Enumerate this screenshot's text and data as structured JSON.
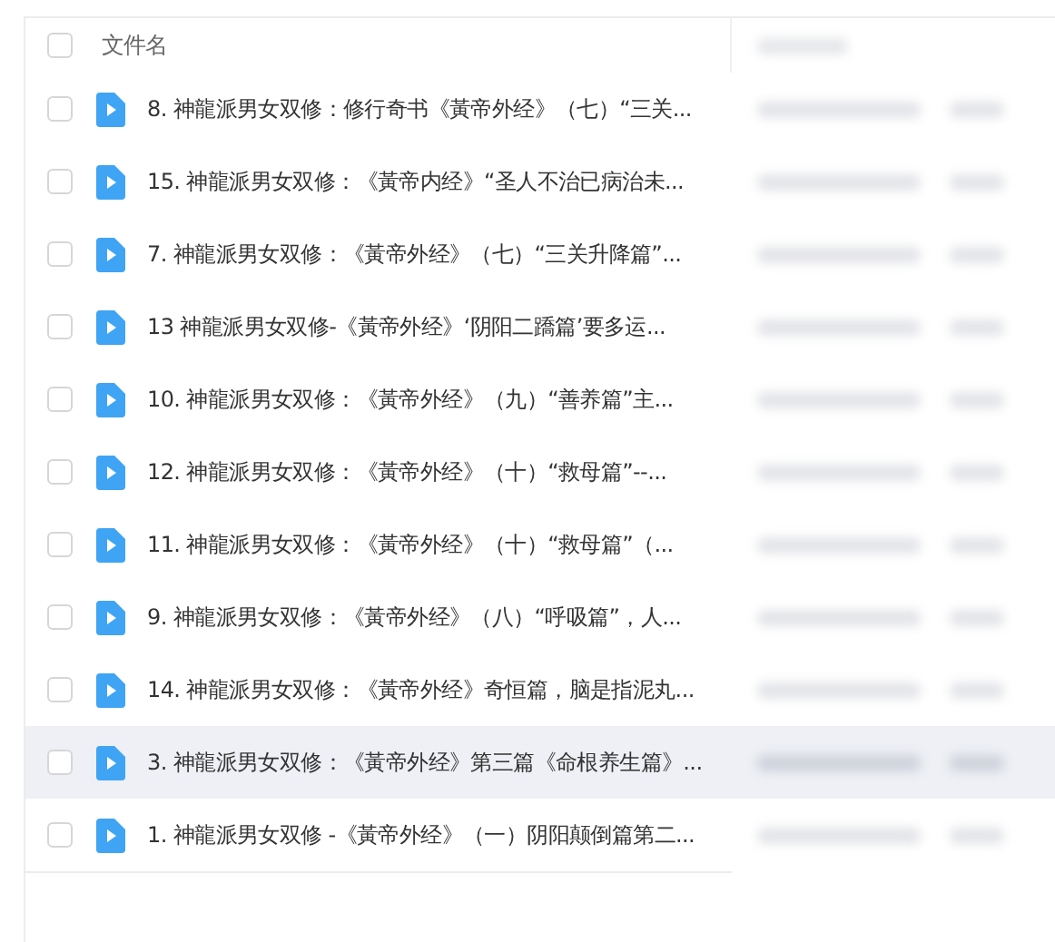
{
  "header": {
    "checked": false,
    "column_1": "文件名"
  },
  "rows": [
    {
      "name": "8. 神龍派男女双修：修行奇书《黃帝外经》（七）“三关...",
      "checked": false,
      "highlighted": false
    },
    {
      "name": "15. 神龍派男女双修：《黃帝内经》“圣人不治已病治未...",
      "checked": false,
      "highlighted": false
    },
    {
      "name": "7. 神龍派男女双修：《黃帝外经》（七）“三关升降篇”...",
      "checked": false,
      "highlighted": false
    },
    {
      "name": "13 神龍派男女双修-《黃帝外经》‘阴阳二蹻篇’要多运...",
      "checked": false,
      "highlighted": false
    },
    {
      "name": "10. 神龍派男女双修：《黃帝外经》（九）“善养篇”主...",
      "checked": false,
      "highlighted": false
    },
    {
      "name": "12. 神龍派男女双修：《黃帝外经》（十）“救母篇”--...",
      "checked": false,
      "highlighted": false
    },
    {
      "name": "11. 神龍派男女双修：《黃帝外经》（十）“救母篇”（...",
      "checked": false,
      "highlighted": false
    },
    {
      "name": "9. 神龍派男女双修：《黃帝外经》（八）“呼吸篇”，人...",
      "checked": false,
      "highlighted": false
    },
    {
      "name": "14. 神龍派男女双修：《黃帝外经》奇恒篇，脑是指泥丸...",
      "checked": false,
      "highlighted": false
    },
    {
      "name": "3. 神龍派男女双修：《黃帝外经》第三篇《命根养生篇》...",
      "checked": false,
      "highlighted": true
    },
    {
      "name": "1. 神龍派男女双修 -《黃帝外经》（一）阴阳颠倒篇第二...",
      "checked": false,
      "highlighted": false
    }
  ]
}
